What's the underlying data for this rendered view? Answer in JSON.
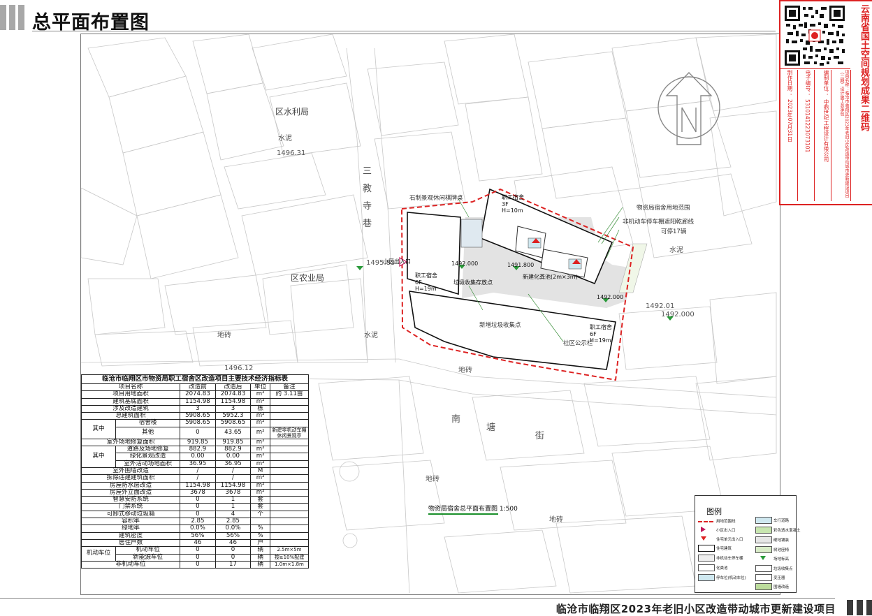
{
  "header": {
    "title": "总平面布置图"
  },
  "footer": {
    "project": "临沧市临翔区2023年老旧小区改造带动城市更新建设项目"
  },
  "stamp": {
    "title": "云南省国土空间规划成果二维码",
    "project": "项目名称：临沧市临翔区2023年老旧小区改造带动城市更新建设项目（二期）设计施工总承包",
    "unit_label": "编制单位：",
    "unit": "中鼎世纪工程设计有限公司",
    "code_label": "电子编号：",
    "code": "5310141223073101",
    "date_label": "制作日期：",
    "date": "2023年07月31日"
  },
  "map": {
    "labels": [
      {
        "text": "区水利局",
        "cls": "big"
      },
      {
        "text": "水泥",
        "cls": ""
      },
      {
        "text": "1496.31",
        "cls": ""
      },
      {
        "text": "区农业局",
        "cls": "big"
      },
      {
        "text": "地砖",
        "cls": ""
      },
      {
        "text": "水泥",
        "cls": ""
      },
      {
        "text": "1496.12",
        "cls": ""
      },
      {
        "text": "1495.83",
        "cls": ""
      },
      {
        "text": "1492.01",
        "cls": ""
      },
      {
        "text": "1492.000",
        "cls": ""
      },
      {
        "text": "水泥",
        "cls": ""
      },
      {
        "text": "南",
        "cls": "road"
      },
      {
        "text": "塘",
        "cls": "road"
      },
      {
        "text": "街",
        "cls": "road"
      },
      {
        "text": "地砖",
        "cls": ""
      },
      {
        "text": "地砖",
        "cls": ""
      },
      {
        "text": "地砖",
        "cls": ""
      },
      {
        "text": "三",
        "cls": "road"
      },
      {
        "text": "教",
        "cls": "road"
      },
      {
        "text": "寺",
        "cls": "road"
      },
      {
        "text": "巷",
        "cls": "road"
      }
    ],
    "site_labels": [
      {
        "text": "职工宿舍 6F H=19m"
      },
      {
        "text": "职工宿舍 6F H=19m"
      },
      {
        "text": "职工宿舍 3F H=10m"
      },
      {
        "text": "小区出入口"
      },
      {
        "text": "1491.800"
      },
      {
        "text": "1492.000"
      },
      {
        "text": "1492.000"
      },
      {
        "text": "垃圾收集存放点"
      },
      {
        "text": "新建化粪池(2m×3m)"
      }
    ],
    "annotations": [
      {
        "text": "石制景观休闲棋牌桌"
      },
      {
        "text": "物资局宿舍用地范围"
      },
      {
        "text": "非机动车停车棚遮阳乾廊线"
      },
      {
        "text": "可停17辆"
      },
      {
        "text": "新增垃圾收集点"
      },
      {
        "text": "社区公示栏"
      }
    ],
    "plan_title": "物资局宿舍总平面布置图 1:500"
  },
  "table": {
    "title": "临沧市临翔区市物资局职工宿舍区改造项目主要技术经济指标表",
    "head": [
      "项目名称",
      "改造前",
      "改造后",
      "单位",
      "备注"
    ],
    "rows": [
      {
        "name": "项目用地面积",
        "before": "2074.83",
        "after": "2074.83",
        "unit": "m²",
        "note": "约 3.11亩"
      },
      {
        "name": "建筑基底面积",
        "before": "1154.98",
        "after": "1154.98",
        "unit": "m²",
        "note": ""
      },
      {
        "name": "涉及改造建筑",
        "before": "3",
        "after": "3",
        "unit": "栋",
        "note": ""
      },
      {
        "name": "总建筑面积",
        "before": "5908.65",
        "after": "5952.3",
        "unit": "m²",
        "note": ""
      },
      {
        "group": "其中",
        "sub": "宿舍楼",
        "before": "5908.65",
        "after": "5908.65",
        "unit": "m²",
        "note": ""
      },
      {
        "sub": "其他",
        "before": "0",
        "after": "43.65",
        "unit": "m²",
        "note": "新建非机动车棚休闲景观亭"
      },
      {
        "name": "室外场地修复面积",
        "before": "919.85",
        "after": "919.85",
        "unit": "m²",
        "note": ""
      },
      {
        "group": "其中",
        "sub": "道路及场地修复",
        "before": "882.9",
        "after": "882.9",
        "unit": "m²",
        "note": ""
      },
      {
        "sub": "绿化景观改造",
        "before": "0.00",
        "after": "0.00",
        "unit": "m²",
        "note": ""
      },
      {
        "sub": "室外活动场地面积",
        "before": "36.95",
        "after": "36.95",
        "unit": "m²",
        "note": ""
      },
      {
        "name": "室外围墙改造",
        "before": "/",
        "after": "/",
        "unit": "M",
        "note": ""
      },
      {
        "name": "拆除违建建筑面积",
        "before": "/",
        "after": "/",
        "unit": "m²",
        "note": ""
      },
      {
        "name": "房屋防水层改造",
        "before": "1154.98",
        "after": "1154.98",
        "unit": "m²",
        "note": ""
      },
      {
        "name": "房屋外立面改造",
        "before": "3678",
        "after": "3678",
        "unit": "m²",
        "note": ""
      },
      {
        "name": "智慧安防系统",
        "before": "0",
        "after": "1",
        "unit": "套",
        "note": ""
      },
      {
        "name": "门禁系统",
        "before": "0",
        "after": "1",
        "unit": "套",
        "note": ""
      },
      {
        "name": "可卸式移动垃圾箱",
        "before": "0",
        "after": "4",
        "unit": "个",
        "note": ""
      },
      {
        "name": "容积率",
        "before": "2.85",
        "after": "2.85",
        "unit": "",
        "note": ""
      },
      {
        "name": "绿地率",
        "before": "0.0%",
        "after": "0.0%",
        "unit": "%",
        "note": ""
      },
      {
        "name": "建筑密度",
        "before": "56%",
        "after": "56%",
        "unit": "%",
        "note": ""
      },
      {
        "name": "居住户数",
        "before": "46",
        "after": "46",
        "unit": "户",
        "note": ""
      },
      {
        "group": "机动车位",
        "sub": "机动车位",
        "before": "0",
        "after": "0",
        "unit": "辆",
        "note": "2.5m×5m"
      },
      {
        "sub": "新能源车位",
        "before": "0",
        "after": "0",
        "unit": "辆",
        "note": "按≥10%配建"
      },
      {
        "name": "非机动车位",
        "before": "0",
        "after": "17",
        "unit": "辆",
        "note": "1.0m×1.8m"
      }
    ]
  },
  "legend": {
    "title": "图例",
    "items": [
      "用地范围线",
      "小区出入口",
      "住宅单元出入口",
      "住宅建筑",
      "非机动车停车棚",
      "化粪池",
      "停车位(机动车位)",
      "车行道路",
      "彩色透水混凝土",
      "硬地铺装",
      "树池座椅",
      "场地标高",
      "垃圾收集点",
      "变压器",
      "围墙改造"
    ]
  }
}
